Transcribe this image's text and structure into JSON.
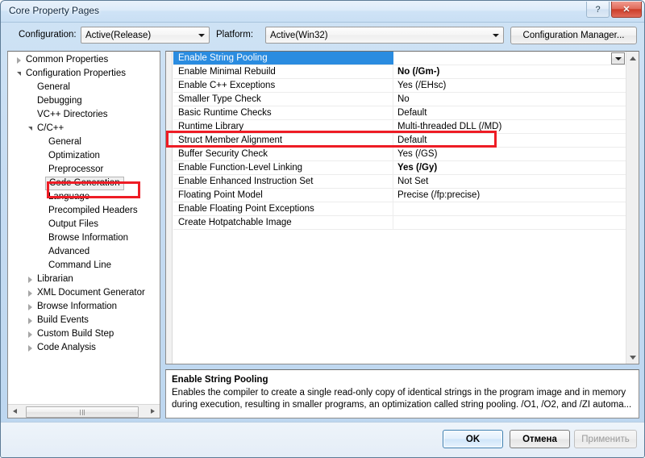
{
  "window": {
    "title": "Core Property Pages",
    "help_button": "?",
    "close_button": "✕"
  },
  "toolbar": {
    "configuration_label": "Configuration:",
    "configuration_value": "Active(Release)",
    "platform_label": "Platform:",
    "platform_value": "Active(Win32)",
    "configuration_manager_button": "Configuration Manager..."
  },
  "tree": {
    "nodes": [
      {
        "label": "Common Properties",
        "indent": 0,
        "state": "collapsed",
        "selected": false
      },
      {
        "label": "Configuration Properties",
        "indent": 0,
        "state": "expanded",
        "selected": false
      },
      {
        "label": "General",
        "indent": 1,
        "state": "leaf",
        "selected": false
      },
      {
        "label": "Debugging",
        "indent": 1,
        "state": "leaf",
        "selected": false
      },
      {
        "label": "VC++ Directories",
        "indent": 1,
        "state": "leaf",
        "selected": false
      },
      {
        "label": "C/C++",
        "indent": 1,
        "state": "expanded",
        "selected": false
      },
      {
        "label": "General",
        "indent": 2,
        "state": "leaf",
        "selected": false
      },
      {
        "label": "Optimization",
        "indent": 2,
        "state": "leaf",
        "selected": false
      },
      {
        "label": "Preprocessor",
        "indent": 2,
        "state": "leaf",
        "selected": false
      },
      {
        "label": "Code Generation",
        "indent": 2,
        "state": "leaf",
        "selected": true
      },
      {
        "label": "Language",
        "indent": 2,
        "state": "leaf",
        "selected": false
      },
      {
        "label": "Precompiled Headers",
        "indent": 2,
        "state": "leaf",
        "selected": false
      },
      {
        "label": "Output Files",
        "indent": 2,
        "state": "leaf",
        "selected": false
      },
      {
        "label": "Browse Information",
        "indent": 2,
        "state": "leaf",
        "selected": false
      },
      {
        "label": "Advanced",
        "indent": 2,
        "state": "leaf",
        "selected": false
      },
      {
        "label": "Command Line",
        "indent": 2,
        "state": "leaf",
        "selected": false
      },
      {
        "label": "Librarian",
        "indent": 1,
        "state": "collapsed",
        "selected": false
      },
      {
        "label": "XML Document Generator",
        "indent": 1,
        "state": "collapsed",
        "selected": false
      },
      {
        "label": "Browse Information",
        "indent": 1,
        "state": "collapsed",
        "selected": false
      },
      {
        "label": "Build Events",
        "indent": 1,
        "state": "collapsed",
        "selected": false
      },
      {
        "label": "Custom Build Step",
        "indent": 1,
        "state": "collapsed",
        "selected": false
      },
      {
        "label": "Code Analysis",
        "indent": 1,
        "state": "collapsed",
        "selected": false
      }
    ]
  },
  "grid": {
    "rows": [
      {
        "name": "Enable String Pooling",
        "value": "",
        "bold": false,
        "selected": true,
        "highlighted": false
      },
      {
        "name": "Enable Minimal Rebuild",
        "value": "No (/Gm-)",
        "bold": true,
        "selected": false,
        "highlighted": false
      },
      {
        "name": "Enable C++ Exceptions",
        "value": "Yes (/EHsc)",
        "bold": false,
        "selected": false,
        "highlighted": false
      },
      {
        "name": "Smaller Type Check",
        "value": "No",
        "bold": false,
        "selected": false,
        "highlighted": false
      },
      {
        "name": "Basic Runtime Checks",
        "value": "Default",
        "bold": false,
        "selected": false,
        "highlighted": false
      },
      {
        "name": "Runtime Library",
        "value": "Multi-threaded DLL (/MD)",
        "bold": false,
        "selected": false,
        "highlighted": true
      },
      {
        "name": "Struct Member Alignment",
        "value": "Default",
        "bold": false,
        "selected": false,
        "highlighted": false
      },
      {
        "name": "Buffer Security Check",
        "value": "Yes (/GS)",
        "bold": false,
        "selected": false,
        "highlighted": false
      },
      {
        "name": "Enable Function-Level Linking",
        "value": "Yes (/Gy)",
        "bold": true,
        "selected": false,
        "highlighted": false
      },
      {
        "name": "Enable Enhanced Instruction Set",
        "value": "Not Set",
        "bold": false,
        "selected": false,
        "highlighted": false
      },
      {
        "name": "Floating Point Model",
        "value": "Precise (/fp:precise)",
        "bold": false,
        "selected": false,
        "highlighted": false
      },
      {
        "name": "Enable Floating Point Exceptions",
        "value": "",
        "bold": false,
        "selected": false,
        "highlighted": false
      },
      {
        "name": "Create Hotpatchable Image",
        "value": "",
        "bold": false,
        "selected": false,
        "highlighted": false
      }
    ]
  },
  "description": {
    "title": "Enable String Pooling",
    "body": "Enables the compiler to create a single read-only copy of identical strings in the program image and in memory during execution, resulting in smaller programs, an optimization called string pooling. /O1, /O2, and /ZI  automa..."
  },
  "footer": {
    "ok": "OK",
    "cancel": "Отмена",
    "apply": "Применить"
  },
  "colors": {
    "selection_blue": "#2a8ce0",
    "annotation_red": "#ee1c25",
    "title_bar": "#cfe3f5"
  }
}
